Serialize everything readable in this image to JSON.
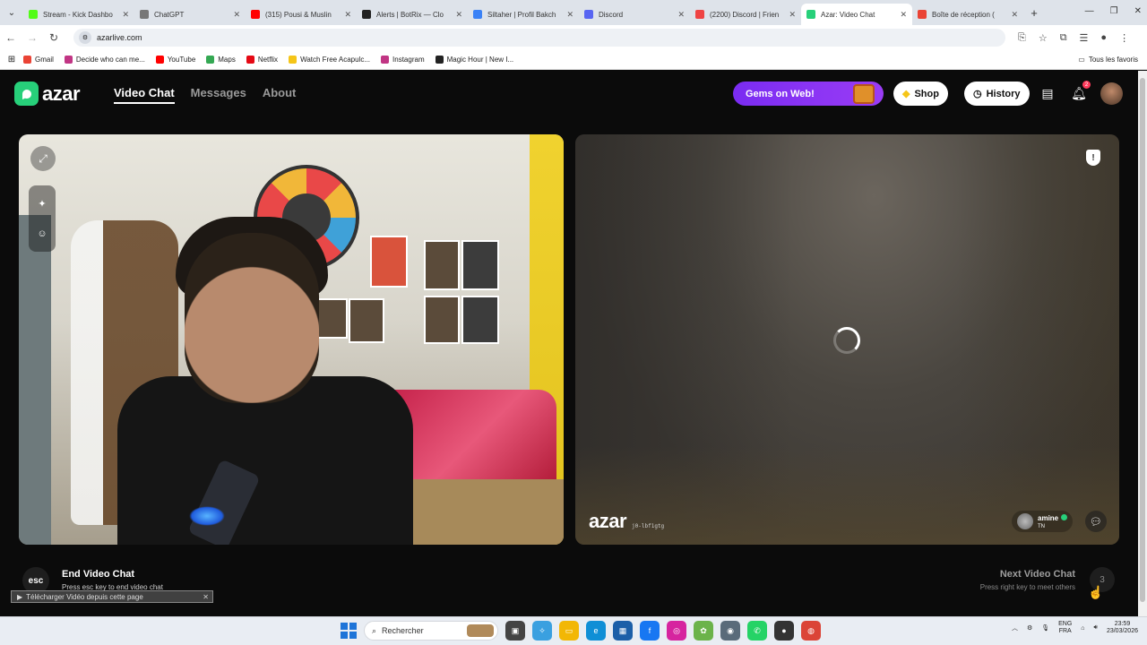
{
  "browser": {
    "tabs": [
      {
        "title": "Stream - Kick Dashbo",
        "color": "#53fc18",
        "active": false
      },
      {
        "title": "ChatGPT",
        "color": "#777777",
        "active": false
      },
      {
        "title": "(315) Pousi & Muslin",
        "color": "#ff0000",
        "active": false
      },
      {
        "title": "Alerts | BotRix — Clo",
        "color": "#222222",
        "active": false
      },
      {
        "title": "Siltaher | Profil Bakch",
        "color": "#3b82f6",
        "active": false
      },
      {
        "title": "Discord",
        "color": "#5865f2",
        "active": false
      },
      {
        "title": "(2200) Discord | Frien",
        "color": "#ef4444",
        "active": false
      },
      {
        "title": "Azar: Video Chat",
        "color": "#27d07a",
        "active": true
      },
      {
        "title": "Boîte de réception (",
        "color": "#ea4335",
        "active": false
      }
    ],
    "url": "azarlive.com",
    "bookmarks": [
      {
        "label": "Gmail",
        "color": "#ea4335"
      },
      {
        "label": "Decide who can me...",
        "color": "#c13584"
      },
      {
        "label": "YouTube",
        "color": "#ff0000"
      },
      {
        "label": "Maps",
        "color": "#34a853"
      },
      {
        "label": "Netflix",
        "color": "#e50914"
      },
      {
        "label": "Watch Free Acapulc...",
        "color": "#f5c518"
      },
      {
        "label": "Instagram",
        "color": "#c13584"
      },
      {
        "label": "Magic Hour | New I...",
        "color": "#222222"
      }
    ],
    "all_bookmarks": "Tous les favoris"
  },
  "azar": {
    "logo_text": "azar",
    "nav": {
      "video_chat": "Video Chat",
      "messages": "Messages",
      "about": "About"
    },
    "gems_banner": "Gems on Web!",
    "shop_label": "Shop",
    "history_label": "History",
    "notification_count": "2",
    "remote": {
      "watermark": "azar",
      "session_id": "j0-lbf1gtg",
      "peer_name": "amine",
      "peer_country": "TN"
    },
    "controls": {
      "esc_key": "esc",
      "end_title": "End Video Chat",
      "end_sub": "Press esc key to end video chat",
      "next_title": "Next Video Chat",
      "next_sub": "Press right key to meet others",
      "next_key": "3"
    },
    "download_bar": "Télécharger Vidéo depuis cette page"
  },
  "taskbar": {
    "search_placeholder": "Rechercher",
    "lang_top": "ENG",
    "lang_bottom": "FRA",
    "time": "23:59",
    "date": "23/03/2026"
  }
}
